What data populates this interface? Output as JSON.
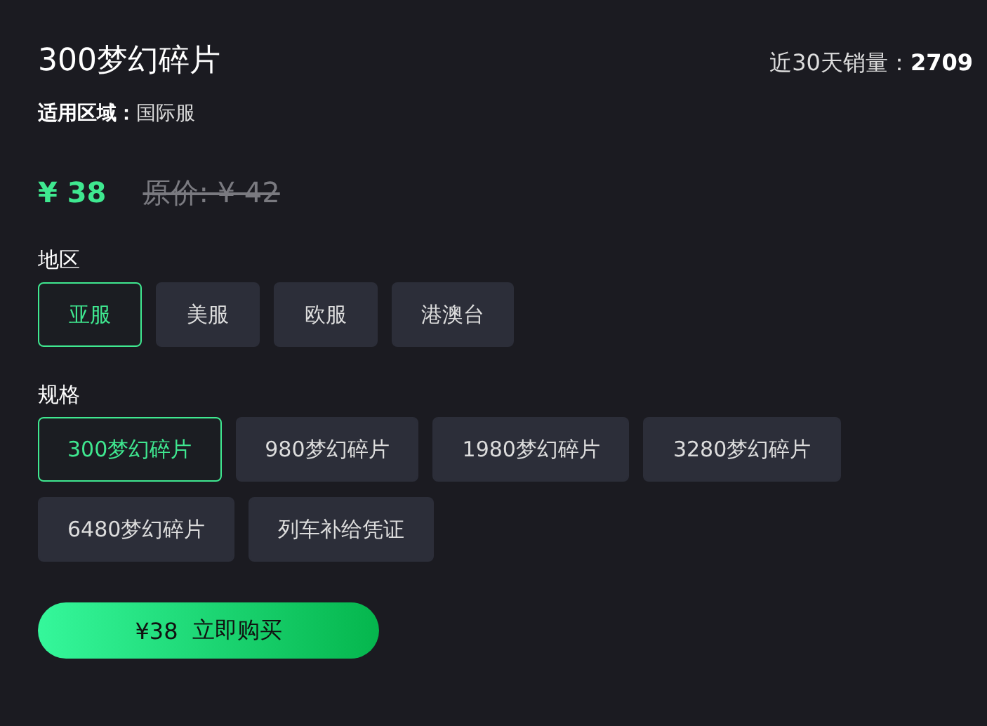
{
  "product": {
    "title": "300梦幻碎片",
    "sales": "近30天销量：**2709**",
    "region_note": "**适用区域：**国际服"
  },
  "price": {
    "current": "¥ 38",
    "original": "原价: ¥ 42"
  },
  "option_groups": [
    {
      "label": "地区",
      "options": [
        {
          "label": "亚服",
          "selected": true
        },
        {
          "label": "美服",
          "selected": false
        },
        {
          "label": "欧服",
          "selected": false
        },
        {
          "label": "港澳台",
          "selected": false
        }
      ]
    },
    {
      "label": "规格",
      "options": [
        {
          "label": "300梦幻碎片",
          "selected": true
        },
        {
          "label": "980梦幻碎片",
          "selected": false
        },
        {
          "label": "1980梦幻碎片",
          "selected": false
        },
        {
          "label": "3280梦幻碎片",
          "selected": false
        },
        {
          "label": "6480梦幻碎片",
          "selected": false
        },
        {
          "label": "列车补给凭证",
          "selected": false
        }
      ]
    }
  ],
  "buy_button": {
    "price": "¥38",
    "label": "立即购买"
  }
}
